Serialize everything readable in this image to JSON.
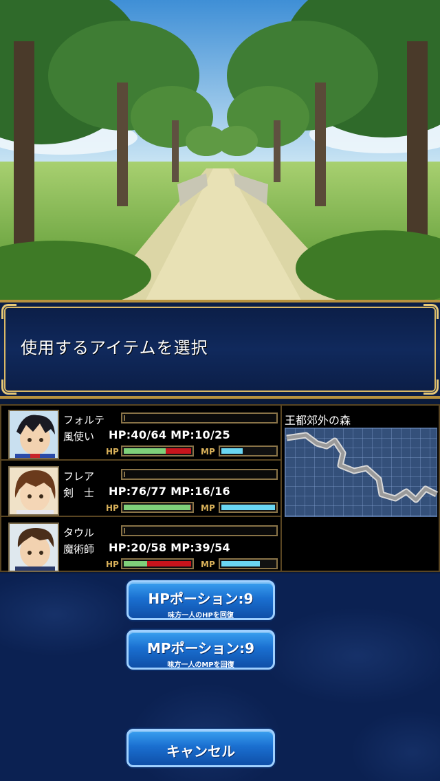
{
  "message": {
    "text": "使用するアイテムを選択"
  },
  "party": [
    {
      "name": "フォルテ",
      "job": "風使い",
      "stats": "HP:40/64 MP:10/25",
      "hp_ratio": 0.625,
      "mp_ratio": 0.4
    },
    {
      "name": "フレア",
      "job": "剣　士",
      "stats": "HP:76/77 MP:16/16",
      "hp_ratio": 0.987,
      "mp_ratio": 1.0
    },
    {
      "name": "タウル",
      "job": "魔術師",
      "stats": "HP:20/58 MP:39/54",
      "hp_ratio": 0.345,
      "mp_ratio": 0.722
    }
  ],
  "bar_labels": {
    "hp": "HP",
    "mp": "MP"
  },
  "map": {
    "title": "王都郊外の森"
  },
  "items": [
    {
      "label": "HPポーション:9",
      "description": "味方一人のHPを回復"
    },
    {
      "label": "MPポーション:9",
      "description": "味方一人のMPを回復"
    }
  ],
  "cancel_label": "キャンセル",
  "colors": {
    "hp_fill": "#7fd07a",
    "hp_deplete": "#c8141c",
    "mp_fill": "#6ad6f2",
    "frame_gold": "#b8923f"
  }
}
